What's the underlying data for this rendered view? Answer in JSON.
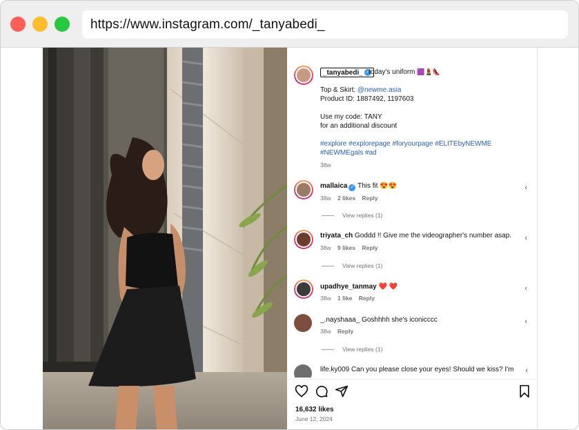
{
  "browser": {
    "url": "https://www.instagram.com/_tanyabedi_"
  },
  "post": {
    "author": "_tanyabedi_",
    "caption_first": "today's uniform",
    "caption_emoji": "🟪💄👠",
    "top_skirt_label": "Top & Skirt: ",
    "top_skirt_handle": "@newme.asia",
    "product_id": "Product ID: 1887492, 1197603",
    "code_line": "Use my code: TANY",
    "discount_line": "for an additional discount",
    "hashtags_line1": "#explore #explorepage #foryourpage #ELITEbyNEWME",
    "hashtags_line2": "#NEWMEgals #ad",
    "age": "38w",
    "likes": "16,632 likes",
    "date": "June 12, 2024"
  },
  "comments": [
    {
      "user": "mallaica",
      "verified": true,
      "text": "This fit 😍😍",
      "age": "38w",
      "likes": "2 likes",
      "reply": "Reply",
      "view_replies": "View replies (1)"
    },
    {
      "user": "triyata_ch",
      "verified": false,
      "text": "Goddd !! Give me the videographer's number asap.",
      "age": "38w",
      "likes": "9 likes",
      "reply": "Reply",
      "view_replies": "View replies (1)"
    },
    {
      "user": "upadhye_tanmay",
      "verified": false,
      "text": "❤️ ❤️",
      "age": "38w",
      "likes": "1 like",
      "reply": "Reply",
      "view_replies": ""
    },
    {
      "user": "_.nayshaaa_",
      "verified": false,
      "text": "Goshhhh she's iconicccc",
      "age": "38w",
      "likes": "",
      "reply": "Reply",
      "view_replies": "View replies (1)"
    },
    {
      "user": "life.ky009",
      "verified": false,
      "text": "Can you please close your eyes! Should we kiss? I'm",
      "age": "",
      "likes": "",
      "reply": "",
      "view_replies": ""
    }
  ],
  "icons": {
    "like": "heart-icon",
    "comment": "comment-icon",
    "share": "send-icon",
    "save": "bookmark-icon",
    "verified": "verified-badge-icon"
  },
  "colors": {
    "link": "#2a5db0",
    "verified": "#3897f0",
    "heart": "#e0245e"
  }
}
